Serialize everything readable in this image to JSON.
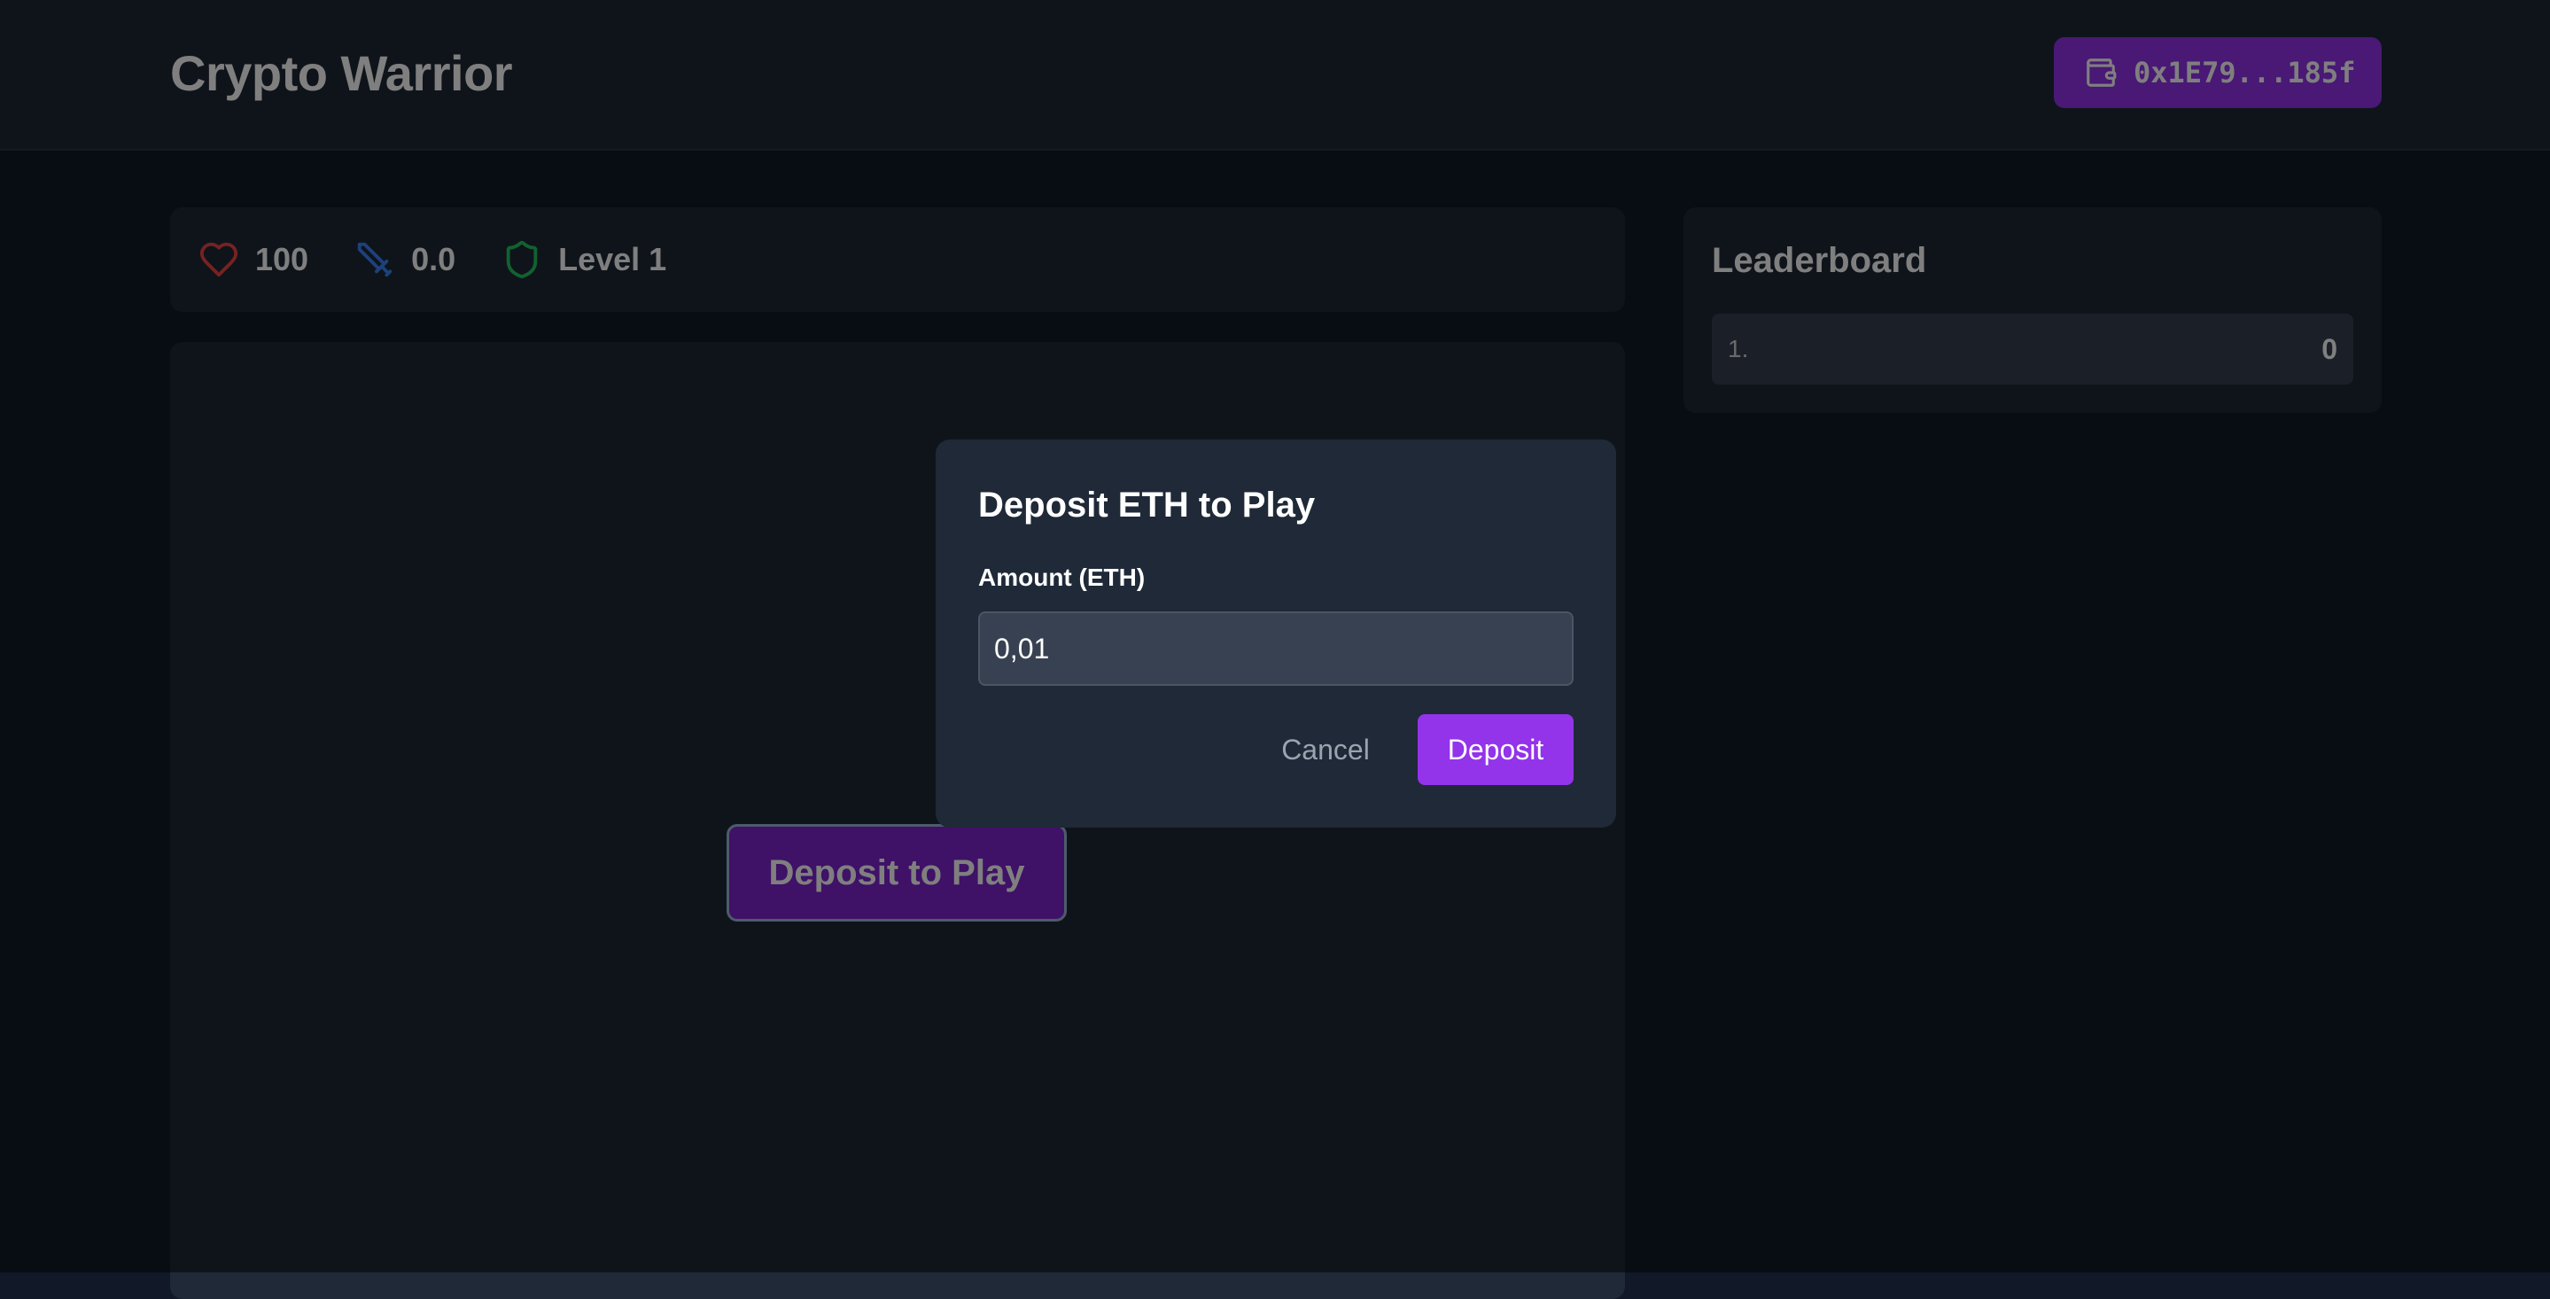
{
  "header": {
    "title": "Crypto Warrior",
    "wallet_address": "0x1E79...185f",
    "wallet_icon": "wallet-icon"
  },
  "stats": {
    "health": "100",
    "health_icon": "heart-icon",
    "attack": "0.0",
    "attack_icon": "sword-icon",
    "level": "Level 1",
    "level_icon": "shield-icon"
  },
  "game": {
    "deposit_to_play_label": "Deposit to Play"
  },
  "leaderboard": {
    "title": "Leaderboard",
    "entries": [
      {
        "rank": "1.",
        "score": "0"
      }
    ]
  },
  "modal": {
    "title": "Deposit ETH to Play",
    "amount_label": "Amount (ETH)",
    "amount_value": "0,01",
    "cancel_label": "Cancel",
    "deposit_label": "Deposit"
  },
  "colors": {
    "accent": "#9333ea",
    "health": "#ef4444",
    "attack": "#3b82f6",
    "level": "#22c55e",
    "panel": "#1f2937",
    "background": "#111827"
  }
}
